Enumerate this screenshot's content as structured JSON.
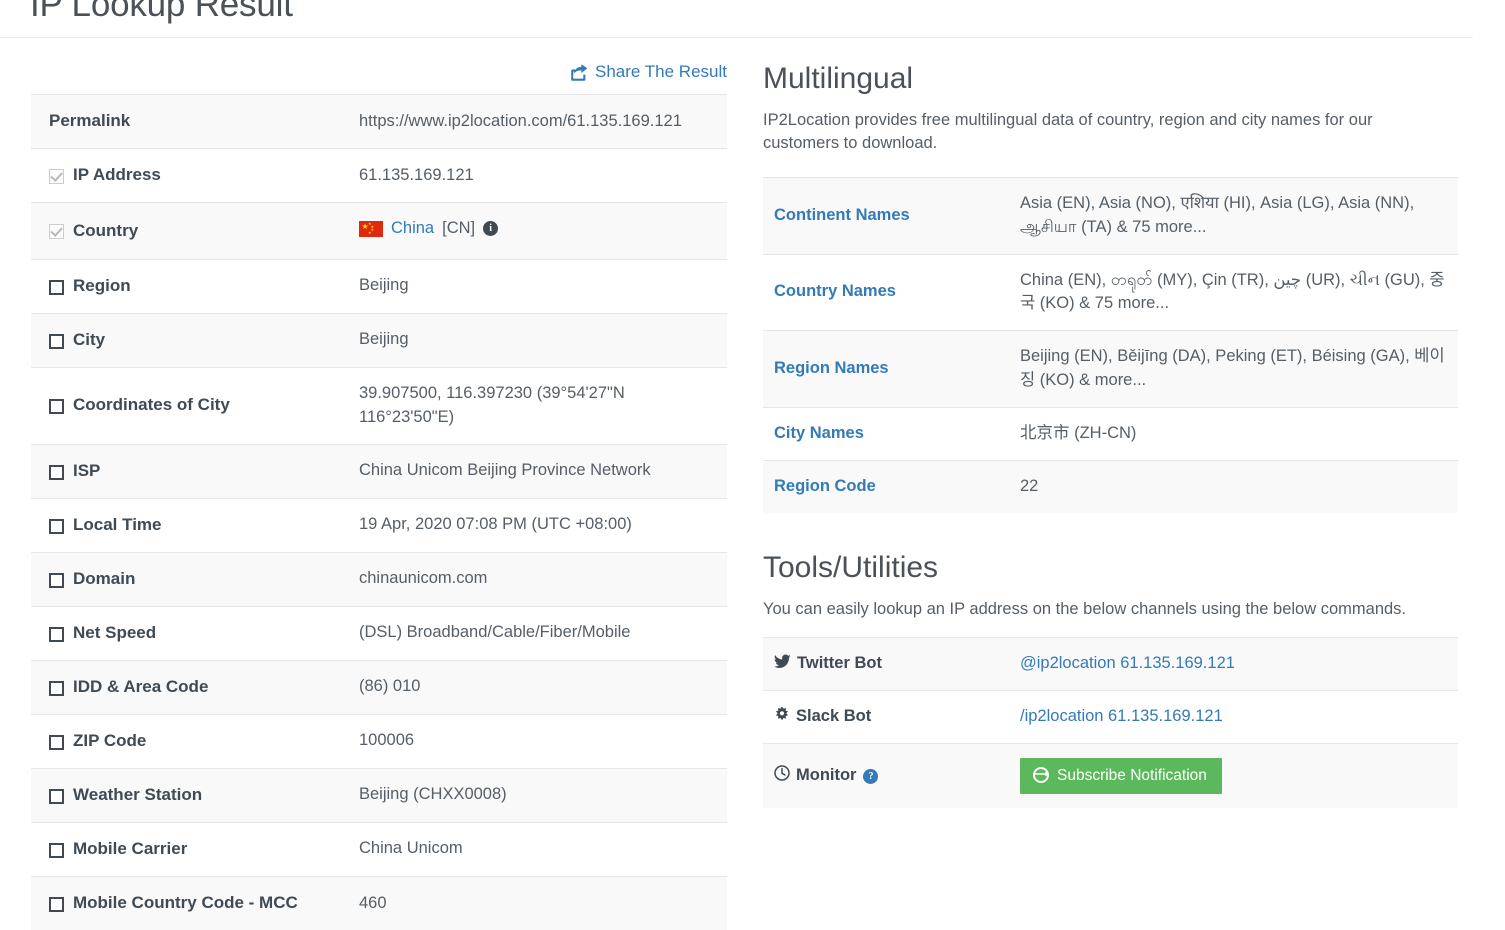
{
  "page": {
    "title": "IP Lookup Result"
  },
  "share": {
    "label": "Share The Result",
    "icon": "share-square-icon"
  },
  "main_table": {
    "rows": [
      {
        "label": "Permalink",
        "value": "https://www.ip2location.com/61.135.169.121",
        "checkbox": "none"
      },
      {
        "label": "IP Address",
        "value": "61.135.169.121",
        "checkbox": "checked"
      },
      {
        "label": "Country",
        "value": "China [CN]",
        "checkbox": "checked",
        "kind": "country",
        "country_name": "China",
        "country_code": "[CN]",
        "flag": "cn-flag-icon",
        "info": "info-circle-icon"
      },
      {
        "label": "Region",
        "value": "Beijing",
        "checkbox": "unchecked"
      },
      {
        "label": "City",
        "value": "Beijing",
        "checkbox": "unchecked"
      },
      {
        "label": "Coordinates of City",
        "value": "39.907500, 116.397230 (39°54'27\"N   116°23'50\"E)",
        "checkbox": "unchecked"
      },
      {
        "label": "ISP",
        "value": "China Unicom Beijing Province Network",
        "checkbox": "unchecked"
      },
      {
        "label": "Local Time",
        "value": "19 Apr, 2020 07:08 PM (UTC +08:00)",
        "checkbox": "unchecked"
      },
      {
        "label": "Domain",
        "value": "chinaunicom.com",
        "checkbox": "unchecked"
      },
      {
        "label": "Net Speed",
        "value": "(DSL) Broadband/Cable/Fiber/Mobile",
        "checkbox": "unchecked"
      },
      {
        "label": "IDD & Area Code",
        "value": "(86) 010",
        "checkbox": "unchecked"
      },
      {
        "label": "ZIP Code",
        "value": "100006",
        "checkbox": "unchecked"
      },
      {
        "label": "Weather Station",
        "value": "Beijing (CHXX0008)",
        "checkbox": "unchecked"
      },
      {
        "label": "Mobile Carrier",
        "value": "China Unicom",
        "checkbox": "unchecked"
      },
      {
        "label": "Mobile Country Code - MCC",
        "value": "460",
        "checkbox": "unchecked"
      }
    ]
  },
  "multilingual": {
    "heading": "Multilingual",
    "description": "IP2Location provides free multilingual data of country, region and city names for our customers to download.",
    "rows": [
      {
        "label": "Continent Names",
        "value": "Asia (EN), Asia (NO), एशिया (HI), Asia (LG), Asia (NN), ஆசியா (TA) & 75 more..."
      },
      {
        "label": "Country Names",
        "value": "China (EN), တရုတ် (MY), Çin (TR), چین (UR), ચીન (GU), 중국 (KO) & 75 more..."
      },
      {
        "label": "Region Names",
        "value": "Beijing (EN), Běijīng (DA), Peking (ET), Béising (GA), 베이징 (KO) & more..."
      },
      {
        "label": "City Names",
        "value": "北京市 (ZH-CN)"
      },
      {
        "label": "Region Code",
        "value": "22"
      }
    ]
  },
  "tools": {
    "heading": "Tools/Utilities",
    "description": "You can easily lookup an IP address on the below channels using the below commands.",
    "rows": [
      {
        "label": "Twitter Bot",
        "icon": "twitter-icon",
        "value": "@ip2location 61.135.169.121",
        "value_type": "link"
      },
      {
        "label": "Slack Bot",
        "icon": "slack-icon",
        "value": "/ip2location 61.135.169.121",
        "value_type": "link"
      },
      {
        "label": "Monitor",
        "icon": "clock-icon",
        "help": "help-circle-icon",
        "value_type": "button",
        "button_label": "Subscribe Notification",
        "button_icon": "arrow-circle-right-icon"
      }
    ]
  },
  "colors": {
    "link": "#337ab7",
    "heading": "#4a5159",
    "row_stripe": "#f9f9f9",
    "button_green": "#5cb85c",
    "flag_red": "#de2910",
    "flag_yellow": "#ffde00"
  }
}
